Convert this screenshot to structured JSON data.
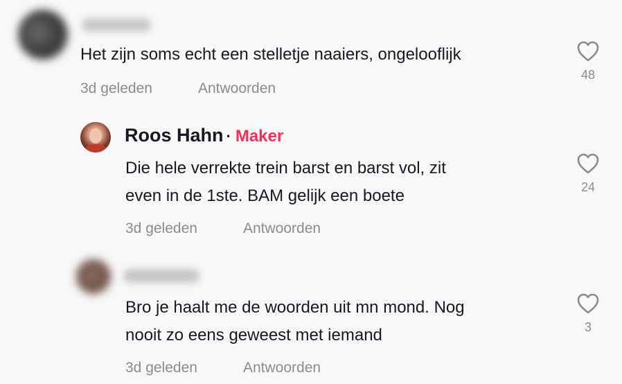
{
  "comments": [
    {
      "text_lines": [
        "Het zijn soms echt een stelletje naaiers, ongelooflijk"
      ],
      "time": "3d geleden",
      "reply": "Antwoorden",
      "likes": "48",
      "like_icon": "heart-outline-icon"
    },
    {
      "author": "Roos Hahn",
      "separator": "·",
      "badge": "Maker",
      "text_lines": [
        "Die hele verrekte trein barst en barst vol, zit",
        "even in de 1ste. BAM gelijk een boete"
      ],
      "time": "3d geleden",
      "reply": "Antwoorden",
      "likes": "24",
      "like_icon": "heart-outline-icon"
    },
    {
      "text_lines": [
        "Bro je haalt me de woorden uit mn mond. Nog",
        "nooit zo eens geweest met iemand"
      ],
      "time": "3d geleden",
      "reply": "Antwoorden",
      "likes": "3",
      "like_icon": "heart-outline-icon"
    }
  ],
  "colors": {
    "badge": "#fe2c55",
    "meta": "#8a8b91",
    "text": "#161823",
    "background": "#f8f8f8"
  }
}
